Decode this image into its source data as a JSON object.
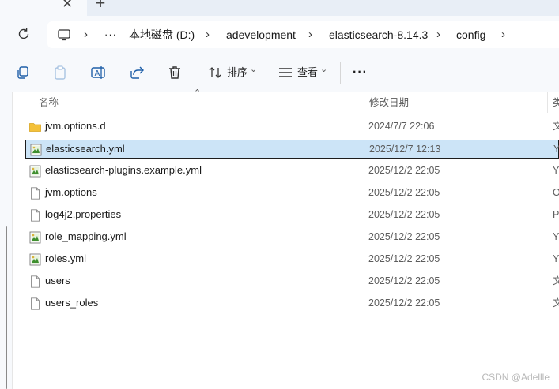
{
  "tabs": {
    "close_glyph": "✕",
    "new_tab_glyph": "+"
  },
  "address": {
    "crumbs": [
      "本地磁盘 (D:)",
      "adevelopment",
      "elasticsearch-8.14.3",
      "config"
    ],
    "overflow": "···",
    "separator": "›"
  },
  "commands": {
    "sort_label": "排序",
    "view_label": "查看",
    "more_label": "···",
    "dropdown_glyph": "⌄"
  },
  "columns": {
    "name": "名称",
    "modified": "修改日期",
    "type": "类"
  },
  "files": [
    {
      "name": "jvm.options.d",
      "modified": "2024/7/7 22:06",
      "type": "文",
      "icon": "folder-icon"
    },
    {
      "name": "elasticsearch.yml",
      "modified": "2025/12/7 12:13",
      "type": "Y",
      "icon": "yml-file-icon",
      "selected": true
    },
    {
      "name": "elasticsearch-plugins.example.yml",
      "modified": "2025/12/2 22:05",
      "type": "Y",
      "icon": "yml-file-icon"
    },
    {
      "name": "jvm.options",
      "modified": "2025/12/2 22:05",
      "type": "O",
      "icon": "file-icon"
    },
    {
      "name": "log4j2.properties",
      "modified": "2025/12/2 22:05",
      "type": "P",
      "icon": "file-icon"
    },
    {
      "name": "role_mapping.yml",
      "modified": "2025/12/2 22:05",
      "type": "Y",
      "icon": "yml-file-icon"
    },
    {
      "name": "roles.yml",
      "modified": "2025/12/2 22:05",
      "type": "Y",
      "icon": "yml-file-icon"
    },
    {
      "name": "users",
      "modified": "2025/12/2 22:05",
      "type": "文",
      "icon": "file-icon"
    },
    {
      "name": "users_roles",
      "modified": "2025/12/2 22:05",
      "type": "文",
      "icon": "file-icon"
    }
  ],
  "watermark": "CSDN @Adellle",
  "colors": {
    "selection": "#cce4f7",
    "folder": "#f4c13a",
    "accent": "#0067c0"
  }
}
